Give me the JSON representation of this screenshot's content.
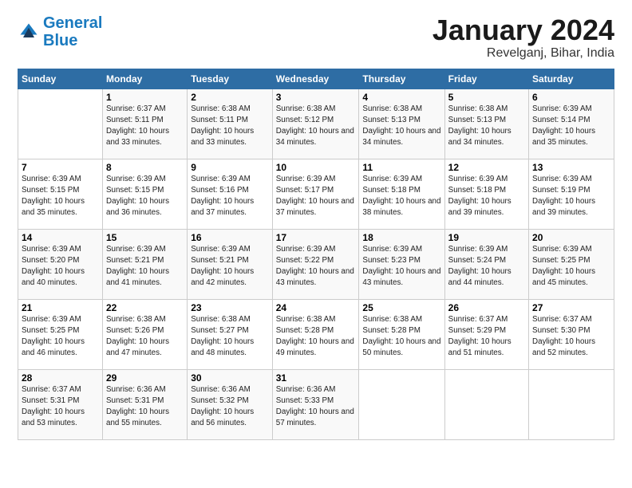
{
  "header": {
    "logo_line1": "General",
    "logo_line2": "Blue",
    "month_title": "January 2024",
    "location": "Revelganj, Bihar, India"
  },
  "calendar": {
    "days_of_week": [
      "Sunday",
      "Monday",
      "Tuesday",
      "Wednesday",
      "Thursday",
      "Friday",
      "Saturday"
    ],
    "weeks": [
      [
        {
          "day": "",
          "sunrise": "",
          "sunset": "",
          "daylight": ""
        },
        {
          "day": "1",
          "sunrise": "Sunrise: 6:37 AM",
          "sunset": "Sunset: 5:11 PM",
          "daylight": "Daylight: 10 hours and 33 minutes."
        },
        {
          "day": "2",
          "sunrise": "Sunrise: 6:38 AM",
          "sunset": "Sunset: 5:11 PM",
          "daylight": "Daylight: 10 hours and 33 minutes."
        },
        {
          "day": "3",
          "sunrise": "Sunrise: 6:38 AM",
          "sunset": "Sunset: 5:12 PM",
          "daylight": "Daylight: 10 hours and 34 minutes."
        },
        {
          "day": "4",
          "sunrise": "Sunrise: 6:38 AM",
          "sunset": "Sunset: 5:13 PM",
          "daylight": "Daylight: 10 hours and 34 minutes."
        },
        {
          "day": "5",
          "sunrise": "Sunrise: 6:38 AM",
          "sunset": "Sunset: 5:13 PM",
          "daylight": "Daylight: 10 hours and 34 minutes."
        },
        {
          "day": "6",
          "sunrise": "Sunrise: 6:39 AM",
          "sunset": "Sunset: 5:14 PM",
          "daylight": "Daylight: 10 hours and 35 minutes."
        }
      ],
      [
        {
          "day": "7",
          "sunrise": "Sunrise: 6:39 AM",
          "sunset": "Sunset: 5:15 PM",
          "daylight": "Daylight: 10 hours and 35 minutes."
        },
        {
          "day": "8",
          "sunrise": "Sunrise: 6:39 AM",
          "sunset": "Sunset: 5:15 PM",
          "daylight": "Daylight: 10 hours and 36 minutes."
        },
        {
          "day": "9",
          "sunrise": "Sunrise: 6:39 AM",
          "sunset": "Sunset: 5:16 PM",
          "daylight": "Daylight: 10 hours and 37 minutes."
        },
        {
          "day": "10",
          "sunrise": "Sunrise: 6:39 AM",
          "sunset": "Sunset: 5:17 PM",
          "daylight": "Daylight: 10 hours and 37 minutes."
        },
        {
          "day": "11",
          "sunrise": "Sunrise: 6:39 AM",
          "sunset": "Sunset: 5:18 PM",
          "daylight": "Daylight: 10 hours and 38 minutes."
        },
        {
          "day": "12",
          "sunrise": "Sunrise: 6:39 AM",
          "sunset": "Sunset: 5:18 PM",
          "daylight": "Daylight: 10 hours and 39 minutes."
        },
        {
          "day": "13",
          "sunrise": "Sunrise: 6:39 AM",
          "sunset": "Sunset: 5:19 PM",
          "daylight": "Daylight: 10 hours and 39 minutes."
        }
      ],
      [
        {
          "day": "14",
          "sunrise": "Sunrise: 6:39 AM",
          "sunset": "Sunset: 5:20 PM",
          "daylight": "Daylight: 10 hours and 40 minutes."
        },
        {
          "day": "15",
          "sunrise": "Sunrise: 6:39 AM",
          "sunset": "Sunset: 5:21 PM",
          "daylight": "Daylight: 10 hours and 41 minutes."
        },
        {
          "day": "16",
          "sunrise": "Sunrise: 6:39 AM",
          "sunset": "Sunset: 5:21 PM",
          "daylight": "Daylight: 10 hours and 42 minutes."
        },
        {
          "day": "17",
          "sunrise": "Sunrise: 6:39 AM",
          "sunset": "Sunset: 5:22 PM",
          "daylight": "Daylight: 10 hours and 43 minutes."
        },
        {
          "day": "18",
          "sunrise": "Sunrise: 6:39 AM",
          "sunset": "Sunset: 5:23 PM",
          "daylight": "Daylight: 10 hours and 43 minutes."
        },
        {
          "day": "19",
          "sunrise": "Sunrise: 6:39 AM",
          "sunset": "Sunset: 5:24 PM",
          "daylight": "Daylight: 10 hours and 44 minutes."
        },
        {
          "day": "20",
          "sunrise": "Sunrise: 6:39 AM",
          "sunset": "Sunset: 5:25 PM",
          "daylight": "Daylight: 10 hours and 45 minutes."
        }
      ],
      [
        {
          "day": "21",
          "sunrise": "Sunrise: 6:39 AM",
          "sunset": "Sunset: 5:25 PM",
          "daylight": "Daylight: 10 hours and 46 minutes."
        },
        {
          "day": "22",
          "sunrise": "Sunrise: 6:38 AM",
          "sunset": "Sunset: 5:26 PM",
          "daylight": "Daylight: 10 hours and 47 minutes."
        },
        {
          "day": "23",
          "sunrise": "Sunrise: 6:38 AM",
          "sunset": "Sunset: 5:27 PM",
          "daylight": "Daylight: 10 hours and 48 minutes."
        },
        {
          "day": "24",
          "sunrise": "Sunrise: 6:38 AM",
          "sunset": "Sunset: 5:28 PM",
          "daylight": "Daylight: 10 hours and 49 minutes."
        },
        {
          "day": "25",
          "sunrise": "Sunrise: 6:38 AM",
          "sunset": "Sunset: 5:28 PM",
          "daylight": "Daylight: 10 hours and 50 minutes."
        },
        {
          "day": "26",
          "sunrise": "Sunrise: 6:37 AM",
          "sunset": "Sunset: 5:29 PM",
          "daylight": "Daylight: 10 hours and 51 minutes."
        },
        {
          "day": "27",
          "sunrise": "Sunrise: 6:37 AM",
          "sunset": "Sunset: 5:30 PM",
          "daylight": "Daylight: 10 hours and 52 minutes."
        }
      ],
      [
        {
          "day": "28",
          "sunrise": "Sunrise: 6:37 AM",
          "sunset": "Sunset: 5:31 PM",
          "daylight": "Daylight: 10 hours and 53 minutes."
        },
        {
          "day": "29",
          "sunrise": "Sunrise: 6:36 AM",
          "sunset": "Sunset: 5:31 PM",
          "daylight": "Daylight: 10 hours and 55 minutes."
        },
        {
          "day": "30",
          "sunrise": "Sunrise: 6:36 AM",
          "sunset": "Sunset: 5:32 PM",
          "daylight": "Daylight: 10 hours and 56 minutes."
        },
        {
          "day": "31",
          "sunrise": "Sunrise: 6:36 AM",
          "sunset": "Sunset: 5:33 PM",
          "daylight": "Daylight: 10 hours and 57 minutes."
        },
        {
          "day": "",
          "sunrise": "",
          "sunset": "",
          "daylight": ""
        },
        {
          "day": "",
          "sunrise": "",
          "sunset": "",
          "daylight": ""
        },
        {
          "day": "",
          "sunrise": "",
          "sunset": "",
          "daylight": ""
        }
      ]
    ]
  }
}
